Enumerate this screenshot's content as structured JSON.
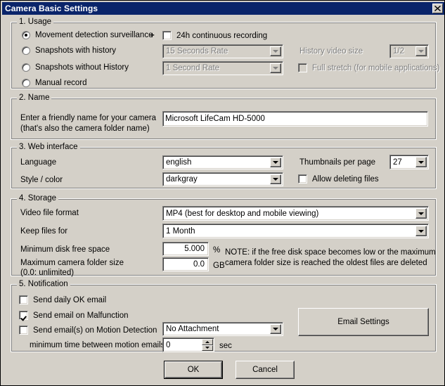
{
  "window": {
    "title": "Camera Basic Settings",
    "close_icon": "close-icon"
  },
  "sections": {
    "usage": {
      "legend": "1. Usage",
      "radios": [
        {
          "label": "Movement detection surveillance",
          "checked": true
        },
        {
          "label": "Snapshots with history",
          "checked": false
        },
        {
          "label": "Snapshots without History",
          "checked": false
        },
        {
          "label": "Manual record",
          "checked": false
        }
      ],
      "plus_sign": "+",
      "continuous_checkbox": {
        "label": "24h continuous recording",
        "checked": false,
        "disabled": false
      },
      "snapshot_rate_combo": {
        "value": "15 Seconds Rate",
        "disabled": true
      },
      "second_rate_combo": {
        "value": "1 Second Rate",
        "disabled": true
      },
      "history_video_size_label": "History video size",
      "history_video_size_combo": {
        "value": "1/2",
        "disabled": true
      },
      "full_stretch_checkbox": {
        "label": "Full stretch (for mobile applications)",
        "checked": false,
        "disabled": true
      }
    },
    "name": {
      "legend": "2. Name",
      "prompt_line1": "Enter a friendly name for your camera",
      "prompt_line2": "(that's also the camera folder name)",
      "camera_name_value": "Microsoft LifeCam HD-5000"
    },
    "web_interface": {
      "legend": "3. Web interface",
      "language_label": "Language",
      "language_combo": {
        "value": "english"
      },
      "style_label": "Style / color",
      "style_combo": {
        "value": "darkgray"
      },
      "thumbnails_label": "Thumbnails per page",
      "thumbnails_combo": {
        "value": "27"
      },
      "allow_delete_checkbox": {
        "label": "Allow deleting files",
        "checked": false
      }
    },
    "storage": {
      "legend": "4. Storage",
      "video_format_label": "Video file format",
      "video_format_combo": {
        "value": "MP4 (best for desktop and mobile viewing)"
      },
      "keep_files_label": "Keep files for",
      "keep_files_combo": {
        "value": "1 Month"
      },
      "min_disk_label": "Minimum disk free space",
      "min_disk_value": "5.000",
      "min_disk_unit": "%",
      "max_folder_label_line1": "Maximum camera folder size",
      "max_folder_label_line2": "(0.0: unlimited)",
      "max_folder_value": "0.0",
      "max_folder_unit": "GB",
      "note_line1": "NOTE: if the free disk space becomes low or the maximum",
      "note_line2": "camera folder size is reached the oldest files are deleted"
    },
    "notification": {
      "legend": "5. Notification",
      "daily_ok_checkbox": {
        "label": "Send daily OK email",
        "checked": false
      },
      "malfunction_checkbox": {
        "label": "Send email on Malfunction",
        "checked": true
      },
      "motion_checkbox": {
        "label": "Send email(s) on Motion Detection",
        "checked": false
      },
      "attachment_combo": {
        "value": "No Attachment"
      },
      "min_time_label": "minimum time between motion emails",
      "min_time_value": "0",
      "min_time_unit": "sec",
      "email_settings_button": "Email Settings"
    }
  },
  "footer": {
    "ok_label": "OK",
    "cancel_label": "Cancel"
  },
  "colors": {
    "titlebar": "#0a246a",
    "face": "#d4d0c8",
    "field": "#ffffff",
    "disabled_text": "#808080"
  }
}
